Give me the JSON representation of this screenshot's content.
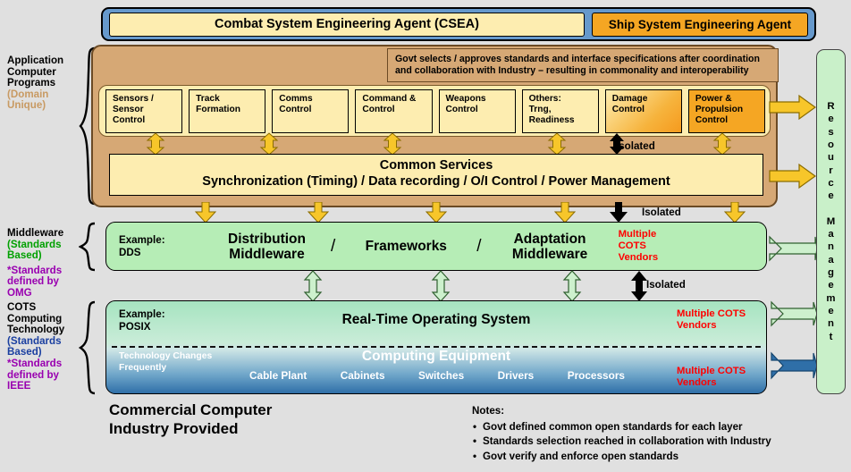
{
  "agents": {
    "csea_label": "Combat System Engineering Agent (CSEA)",
    "ssea_label": "Ship System Engineering Agent"
  },
  "sidebar": {
    "application": {
      "line1": "Application",
      "line2": "Computer",
      "line3": "Programs",
      "note1": "(Domain",
      "note2": "Unique)"
    },
    "middleware": {
      "line1": "Middleware",
      "note1": "(Standards",
      "note2": "Based)",
      "std1": "*Standards",
      "std2": "defined by",
      "std3": "OMG"
    },
    "cots": {
      "line1": "COTS",
      "line2": "Computing",
      "line3": "Technology",
      "note1": "(Standards",
      "note2": "Based)",
      "std1": "*Standards",
      "std2": "defined by",
      "std3": "IEEE"
    }
  },
  "application_layer": {
    "govt_note_line1": "Govt selects / approves standards and interface specifications after coordination",
    "govt_note_line2": "and collaboration with Industry – resulting in commonality and interoperability",
    "boxes": [
      {
        "lines": [
          "Sensors /",
          "Sensor",
          "Control"
        ],
        "style": "plain"
      },
      {
        "lines": [
          "Track",
          "Formation"
        ],
        "style": "plain"
      },
      {
        "lines": [
          "Comms",
          "Control"
        ],
        "style": "plain"
      },
      {
        "lines": [
          "Command &",
          "Control"
        ],
        "style": "plain"
      },
      {
        "lines": [
          "Weapons",
          "Control"
        ],
        "style": "plain"
      },
      {
        "lines": [
          "Others:",
          "Trng,",
          "Readiness"
        ],
        "style": "plain"
      },
      {
        "lines": [
          "Damage",
          "Control"
        ],
        "style": "gradient"
      },
      {
        "lines": [
          "Power &",
          "Propulsion",
          "Control"
        ],
        "style": "orange"
      }
    ],
    "common_services_title": "Common Services",
    "common_services_sub": "Synchronization (Timing)  /  Data recording  /  O/I Control  /  Power Management",
    "isolated_label": "Isolated"
  },
  "middleware_layer": {
    "example_line1": "Example:",
    "example_line2": "DDS",
    "item1": [
      "Distribution",
      "Middleware"
    ],
    "item2": [
      "Frameworks"
    ],
    "item3": [
      "Adaptation",
      "Middleware"
    ],
    "separator": "/",
    "vendors": [
      "Multiple",
      "COTS",
      "Vendors"
    ],
    "isolated_label": "Isolated"
  },
  "cots_layer": {
    "example_line1": "Example:",
    "example_line2": "POSIX",
    "rtos_title": "Real-Time Operating System",
    "rtos_vendors": [
      "Multiple COTS",
      "Vendors"
    ],
    "tech_changes_line1": "Technology Changes",
    "tech_changes_line2": "Frequently",
    "computing_equipment_title": "Computing Equipment",
    "computing_equipment_items": [
      "Cable Plant",
      "Cabinets",
      "Switches",
      "Drivers",
      "Processors"
    ],
    "ce_vendors": [
      "Multiple COTS",
      "Vendors"
    ],
    "isolated_label": "Isolated"
  },
  "resource_management": {
    "label": "Resource Management",
    "letters": "R\ne\ns\no\nu\nr\nc\ne\n \nM\na\nn\na\ng\ne\nm\ne\nn\nt"
  },
  "caption": {
    "line1": "Commercial Computer",
    "line2": "Industry Provided"
  },
  "notes": {
    "title": "Notes:",
    "items": [
      "Govt defined common open standards for each layer",
      "Standards selection reached in collaboration with Industry",
      "Govt verify and enforce open standards"
    ]
  },
  "colors": {
    "agents_bar": "#6699cc",
    "csea": "#fdedb0",
    "ssea": "#f5a623",
    "application_panel": "#d6a875",
    "middleware_panel": "#b6edb6",
    "vendor_red": "#ff0000",
    "resource_column": "#c9f0c9"
  }
}
